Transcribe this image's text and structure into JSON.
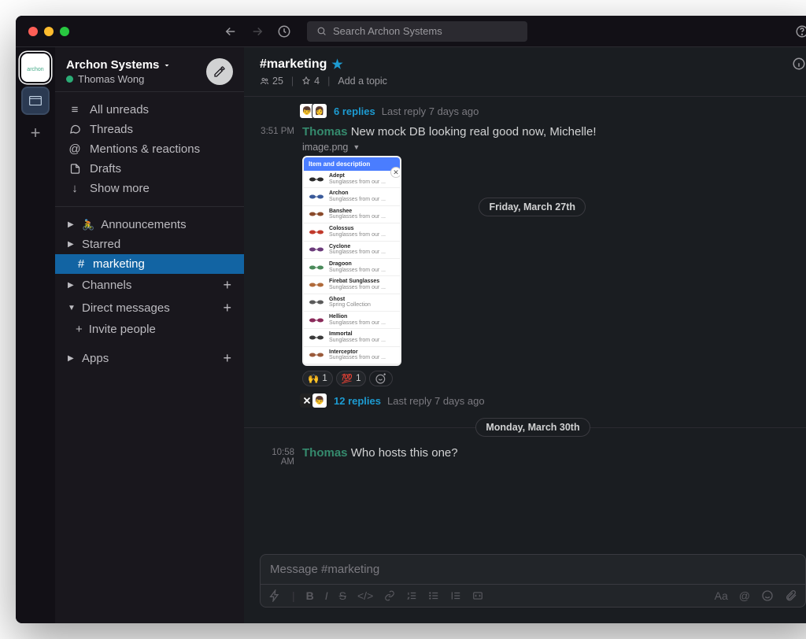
{
  "titlebar": {
    "search_placeholder": "Search Archon Systems"
  },
  "workspace": {
    "name": "Archon Systems",
    "user_name": "Thomas Wong"
  },
  "sidebar": {
    "nav": [
      {
        "label": "All unreads",
        "icon": "≡"
      },
      {
        "label": "Threads",
        "icon": "⧉"
      },
      {
        "label": "Mentions & reactions",
        "icon": "@"
      },
      {
        "label": "Drafts",
        "icon": "🗎"
      },
      {
        "label": "Show more",
        "icon": "↓"
      }
    ],
    "sections": {
      "announcements": "Announcements",
      "starred": "Starred",
      "channels": "Channels",
      "dms": "Direct messages",
      "apps": "Apps",
      "invite": "Invite people"
    },
    "active_channel": "marketing"
  },
  "channel": {
    "name": "#marketing",
    "members": "25",
    "pins": "4",
    "topic_placeholder": "Add a topic"
  },
  "messages": {
    "date1": "Friday, March 27th",
    "date2": "Monday, March 30th",
    "thread1": {
      "replies": "6 replies",
      "meta": "Last reply 7 days ago"
    },
    "msg1": {
      "time": "3:51 PM",
      "author": "Thomas",
      "text": "New mock DB looking real good now, Michelle!"
    },
    "attachment": {
      "filename": "image.png",
      "header": "Item and description",
      "items": [
        {
          "name": "Adept",
          "desc": "Sunglasses from our ..."
        },
        {
          "name": "Archon",
          "desc": "Sunglasses from our ..."
        },
        {
          "name": "Banshee",
          "desc": "Sunglasses from our ..."
        },
        {
          "name": "Colossus",
          "desc": "Sunglasses from our ..."
        },
        {
          "name": "Cyclone",
          "desc": "Sunglasses from our ..."
        },
        {
          "name": "Dragoon",
          "desc": "Sunglasses from our ..."
        },
        {
          "name": "Firebat Sunglasses",
          "desc": "Sunglasses from our ..."
        },
        {
          "name": "Ghost",
          "desc": "Spring Collection"
        },
        {
          "name": "Hellion",
          "desc": "Sunglasses from our ..."
        },
        {
          "name": "Immortal",
          "desc": "Sunglasses from our ..."
        },
        {
          "name": "Interceptor",
          "desc": "Sunglasses from our ..."
        }
      ]
    },
    "reactions": [
      {
        "emoji": "🙌",
        "count": "1"
      },
      {
        "emoji": "💯",
        "count": "1"
      }
    ],
    "thread2": {
      "replies": "12 replies",
      "meta": "Last reply 7 days ago"
    },
    "msg2": {
      "time": "10:58 AM",
      "author": "Thomas",
      "text": "Who hosts this one?"
    }
  },
  "composer": {
    "placeholder": "Message #marketing"
  }
}
